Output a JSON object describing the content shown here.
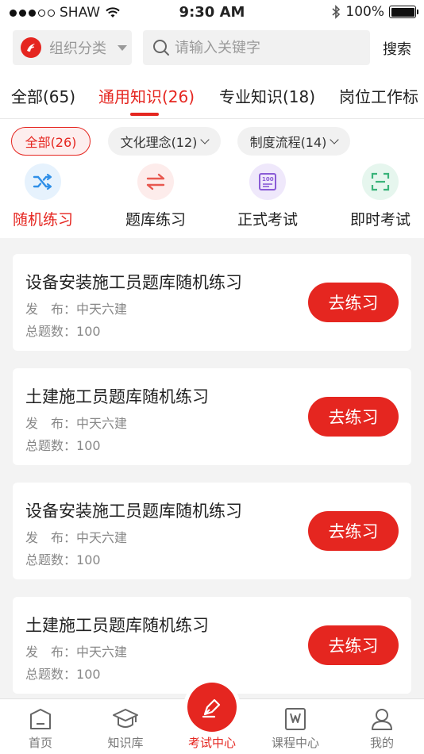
{
  "status_bar": {
    "carrier": "SHAW",
    "time": "9:30 AM",
    "battery": "100%"
  },
  "header": {
    "org_select_label": "组织分类",
    "search_placeholder": "请输入关键字",
    "search_button": "搜索"
  },
  "tabs": [
    {
      "label": "全部(65)"
    },
    {
      "label": "通用知识(26)"
    },
    {
      "label": "专业知识(18)"
    },
    {
      "label": "岗位工作标"
    }
  ],
  "active_tab": 1,
  "chips": [
    {
      "label": "全部(26)"
    },
    {
      "label": "文化理念(12)"
    },
    {
      "label": "制度流程(14)"
    }
  ],
  "modes": [
    {
      "label": "随机练习",
      "icon": "shuffle-icon",
      "color": "#2f8fe8",
      "bg": "#e6f2fd"
    },
    {
      "label": "题库练习",
      "icon": "swap-arrows-icon",
      "color": "#e8584f",
      "bg": "#fdeceb"
    },
    {
      "label": "正式考试",
      "icon": "exam-score-icon",
      "color": "#8a5bd6",
      "bg": "#efe8fb"
    },
    {
      "label": "即时考试",
      "icon": "scan-icon",
      "color": "#3ab37a",
      "bg": "#e6f6ee"
    }
  ],
  "cards": [
    {
      "title": "设备安装施工员题库随机练习",
      "publish_label": "发　布：",
      "publisher": "中天六建",
      "total_label": "总题数：",
      "total": "100",
      "button": "去练习"
    },
    {
      "title": "土建施工员题库随机练习",
      "publish_label": "发　布：",
      "publisher": "中天六建",
      "total_label": "总题数：",
      "total": "100",
      "button": "去练习"
    },
    {
      "title": "设备安装施工员题库随机练习",
      "publish_label": "发　布：",
      "publisher": "中天六建",
      "total_label": "总题数：",
      "total": "100",
      "button": "去练习"
    },
    {
      "title": "土建施工员题库随机练习",
      "publish_label": "发　布：",
      "publisher": "中天六建",
      "total_label": "总题数：",
      "total": "100",
      "button": "去练习"
    }
  ],
  "bottom_nav": [
    {
      "label": "首页",
      "icon": "home-icon"
    },
    {
      "label": "知识库",
      "icon": "graduation-cap-icon"
    },
    {
      "label": "考试中心",
      "icon": "pen-icon"
    },
    {
      "label": "课程中心",
      "icon": "course-book-icon"
    },
    {
      "label": "我的",
      "icon": "user-icon"
    }
  ],
  "colors": {
    "accent": "#e52620",
    "background_list": "#f3f3f3"
  }
}
